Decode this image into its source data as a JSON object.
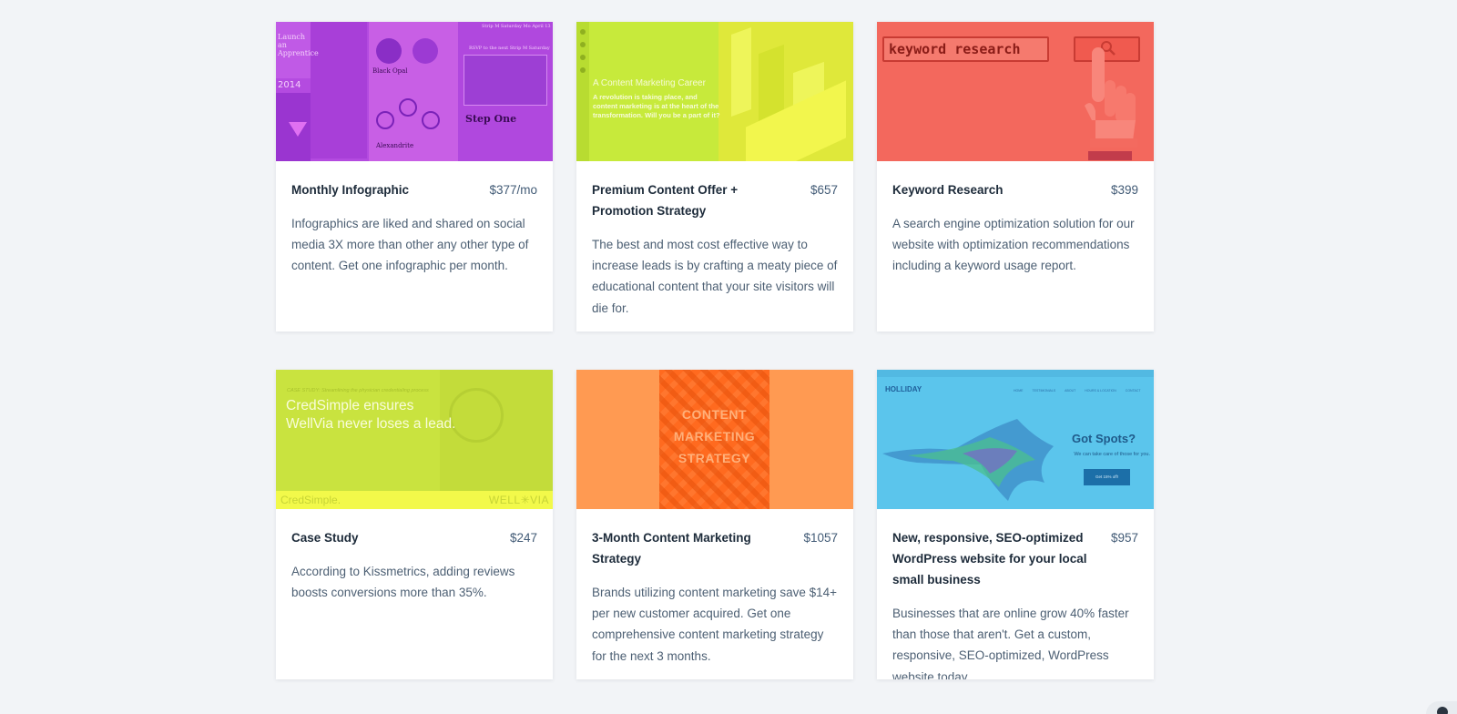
{
  "cards": [
    {
      "title": "Monthly Infographic",
      "price": "$377/mo",
      "description": "Infographics are liked and shared on social media 3X more than other any other type of content. Get one infographic per month.",
      "image": {
        "texts": [
          "Launch an Apprentice",
          "2014",
          "Black Opal",
          "Alexandrite",
          "Step One",
          "Strip M Saturday Mo April 13",
          "RSVP to the next Strip M Saturday"
        ]
      }
    },
    {
      "title": "Premium Content Offer + Promotion Strategy",
      "price": "$657",
      "description": "The best and most cost effective way to increase leads is by crafting a meaty piece of educational content that your site visitors will die for.",
      "image": {
        "heading": "A Content Marketing Career",
        "text": "A revolution is taking place, and content marketing is at the heart of the transformation. Will you be a part of it?"
      }
    },
    {
      "title": "Keyword Research",
      "price": "$399",
      "description": "A search engine optimization solution for our website with optimization recommendations including a keyword usage report.",
      "image": {
        "search_text": "keyword research"
      }
    },
    {
      "title": "Case Study",
      "price": "$247",
      "description": "According to Kissmetrics, adding reviews boosts conversions more than 35%.",
      "image": {
        "caption": "CASE STUDY: Streamlining the physician credentialing process",
        "headline_line1": "CredSimple ensures",
        "headline_line2": "WellVia never loses a lead.",
        "logo_left": "CredSimple.",
        "logo_right": "WELL✳VIA"
      }
    },
    {
      "title": "3-Month Content Marketing Strategy",
      "price": "$1057",
      "description": "Brands utilizing content marketing save $14+ per new customer acquired. Get one comprehensive content marketing strategy for the next 3 months.",
      "image": {
        "lines": [
          "CONTENT",
          "MARKETING",
          "STRATEGY"
        ]
      }
    },
    {
      "title": "New, responsive, SEO-optimized WordPress website for your local small business",
      "price": "$957",
      "description": "Businesses that are online grow 40% faster than those that aren't. Get a custom, responsive, SEO-optimized, WordPress website today.",
      "image": {
        "logo": "HOLLIDAY",
        "nav": [
          "HOME",
          "TESTIMONIALS",
          "ABOUT",
          "HOURS & LOCATION",
          "CONTACT"
        ],
        "headline": "Got Spots?",
        "subtext": "We can take care of those for you.",
        "cta": "Get 15% off!"
      }
    }
  ]
}
